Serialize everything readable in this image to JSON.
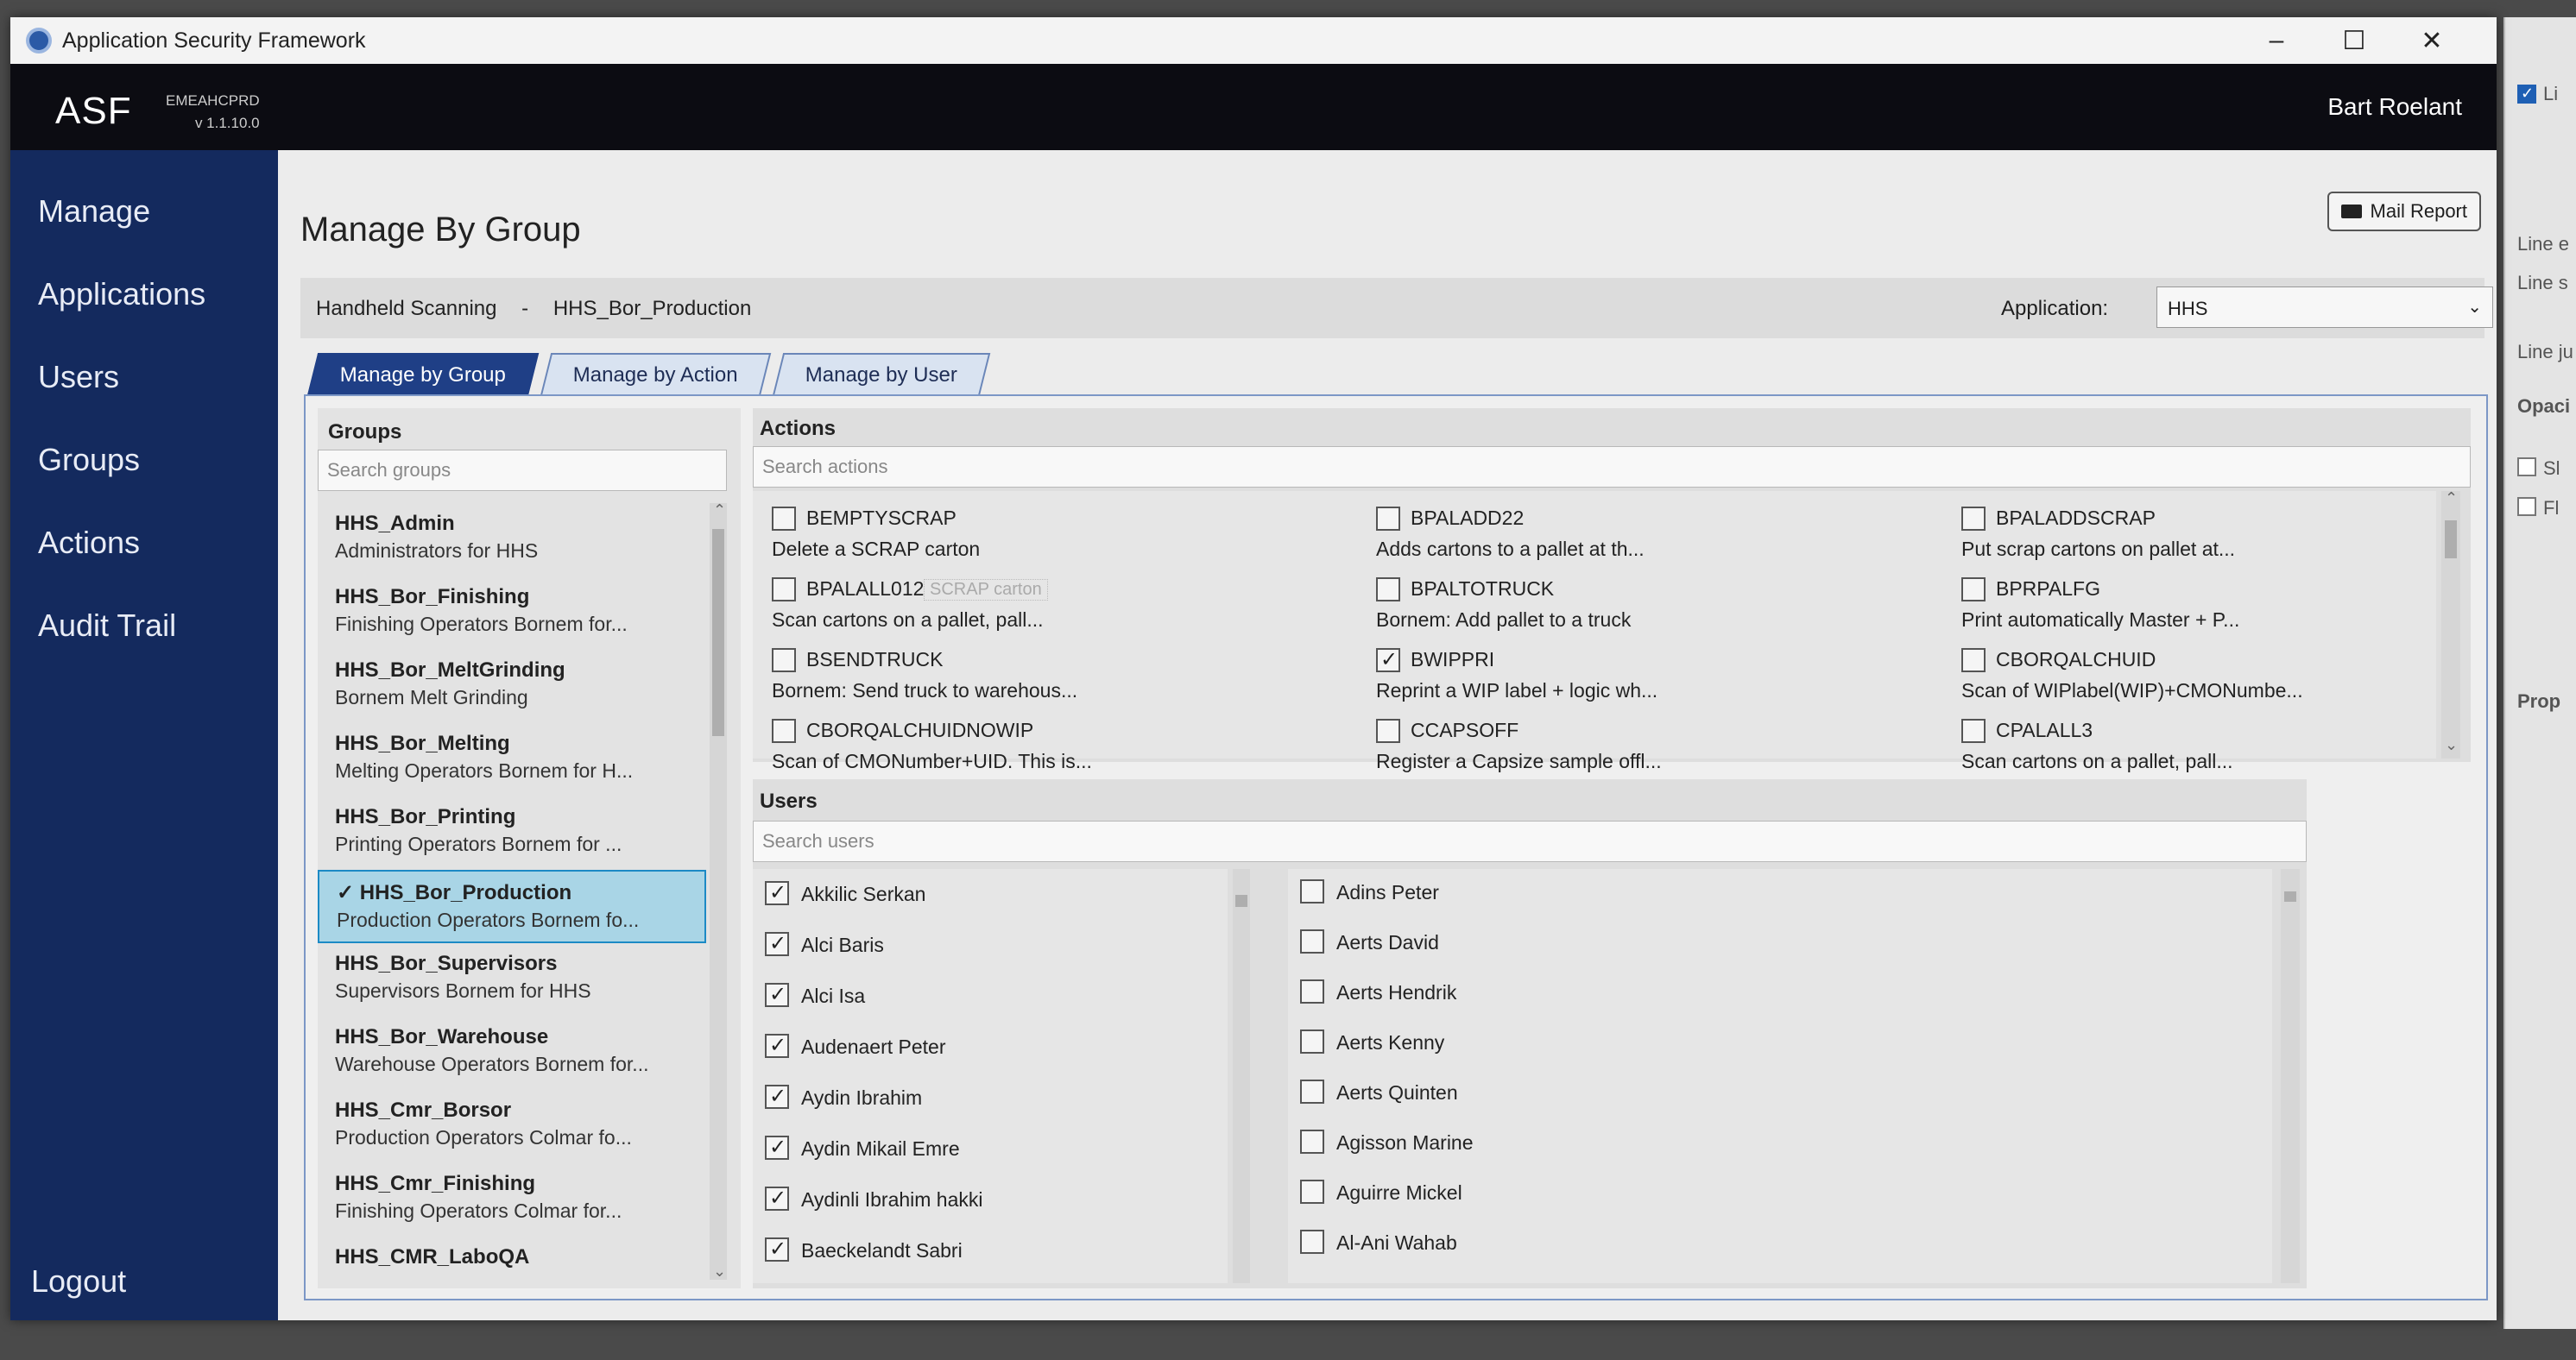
{
  "window": {
    "title": "Application Security Framework",
    "minimize": "–",
    "maximize": "☐",
    "close": "✕"
  },
  "header": {
    "logo": "ASF",
    "env": "EMEAHCPRD",
    "version": "v 1.1.10.0",
    "user": "Bart Roelant"
  },
  "sidebar": {
    "items": [
      "Manage",
      "Applications",
      "Users",
      "Groups",
      "Actions",
      "Audit Trail"
    ],
    "logout": "Logout"
  },
  "page": {
    "title": "Manage By Group",
    "mail_report": "Mail Report",
    "breadcrumb": [
      "Handheld Scanning",
      "-",
      "HHS_Bor_Production"
    ],
    "application_label": "Application:",
    "application_value": "HHS"
  },
  "tabs": [
    "Manage by Group",
    "Manage by Action",
    "Manage by User"
  ],
  "groups": {
    "title": "Groups",
    "search_placeholder": "Search groups",
    "items": [
      {
        "name": "HHS_Admin",
        "desc": "Administrators for HHS",
        "selected": false
      },
      {
        "name": "HHS_Bor_Finishing",
        "desc": "Finishing Operators Bornem for...",
        "selected": false
      },
      {
        "name": "HHS_Bor_MeltGrinding",
        "desc": "Bornem Melt Grinding",
        "selected": false
      },
      {
        "name": "HHS_Bor_Melting",
        "desc": "Melting Operators Bornem for H...",
        "selected": false
      },
      {
        "name": "HHS_Bor_Printing",
        "desc": "Printing Operators Bornem for ...",
        "selected": false
      },
      {
        "name": "✓ HHS_Bor_Production",
        "desc": "Production Operators Bornem fo...",
        "selected": true
      },
      {
        "name": "HHS_Bor_Supervisors",
        "desc": "Supervisors Bornem for HHS",
        "selected": false
      },
      {
        "name": "HHS_Bor_Warehouse",
        "desc": "Warehouse Operators Bornem for...",
        "selected": false
      },
      {
        "name": "HHS_Cmr_Borsor",
        "desc": "Production Operators Colmar fo...",
        "selected": false
      },
      {
        "name": "HHS_Cmr_Finishing",
        "desc": "Finishing Operators Colmar for...",
        "selected": false
      },
      {
        "name": "HHS_CMR_LaboQA",
        "desc": "",
        "selected": false
      }
    ]
  },
  "actions": {
    "title": "Actions",
    "search_placeholder": "Search actions",
    "ghost_label": "SCRAP carton",
    "items": [
      {
        "name": "BEMPTYSCRAP",
        "desc": "Delete a SCRAP carton",
        "checked": false
      },
      {
        "name": "BPALADD22",
        "desc": "Adds cartons to a pallet at th...",
        "checked": false
      },
      {
        "name": "BPALADDSCRAP",
        "desc": "Put scrap cartons on pallet at...",
        "checked": false
      },
      {
        "name": "BPALALL012",
        "desc": "Scan cartons on a pallet, pall...",
        "checked": false
      },
      {
        "name": "BPALTOTRUCK",
        "desc": "Bornem: Add pallet to a truck",
        "checked": false
      },
      {
        "name": "BPRPALFG",
        "desc": "Print automatically Master + P...",
        "checked": false
      },
      {
        "name": "BSENDTRUCK",
        "desc": "Bornem: Send truck to warehous...",
        "checked": false
      },
      {
        "name": "BWIPPRI",
        "desc": "Reprint a WIP label + logic wh...",
        "checked": true
      },
      {
        "name": "CBORQALCHUID",
        "desc": "Scan of WIPlabel(WIP)+CMONumbe...",
        "checked": false
      },
      {
        "name": "CBORQALCHUIDNOWIP",
        "desc": "Scan of CMONumber+UID. This is...",
        "checked": false
      },
      {
        "name": "CCAPSOFF",
        "desc": "Register a Capsize sample offl...",
        "checked": false
      },
      {
        "name": "CPALALL3",
        "desc": "Scan cartons on a pallet, pall...",
        "checked": false
      }
    ]
  },
  "users": {
    "title": "Users",
    "search_placeholder": "Search users",
    "assigned": [
      {
        "name": "Akkilic Serkan",
        "checked": true
      },
      {
        "name": "Alci Baris",
        "checked": true
      },
      {
        "name": "Alci Isa",
        "checked": true
      },
      {
        "name": "Audenaert Peter",
        "checked": true
      },
      {
        "name": "Aydin Ibrahim",
        "checked": true
      },
      {
        "name": "Aydin Mikail Emre",
        "checked": true
      },
      {
        "name": "Aydinli Ibrahim hakki",
        "checked": true
      },
      {
        "name": "Baeckelandt Sabri",
        "checked": true
      }
    ],
    "available": [
      {
        "name": "Adins Peter",
        "checked": false
      },
      {
        "name": "Aerts David",
        "checked": false
      },
      {
        "name": "Aerts Hendrik",
        "checked": false
      },
      {
        "name": "Aerts Kenny",
        "checked": false
      },
      {
        "name": "Aerts Quinten",
        "checked": false
      },
      {
        "name": "Agisson Marine",
        "checked": false
      },
      {
        "name": "Aguirre Mickel",
        "checked": false
      },
      {
        "name": "Al-Ani Wahab",
        "checked": false
      }
    ]
  },
  "side_panel": {
    "items": [
      "Li",
      "Line e",
      "Line s",
      "Line ju",
      "Opaci",
      "Sl",
      "Fl",
      "Prop"
    ]
  }
}
